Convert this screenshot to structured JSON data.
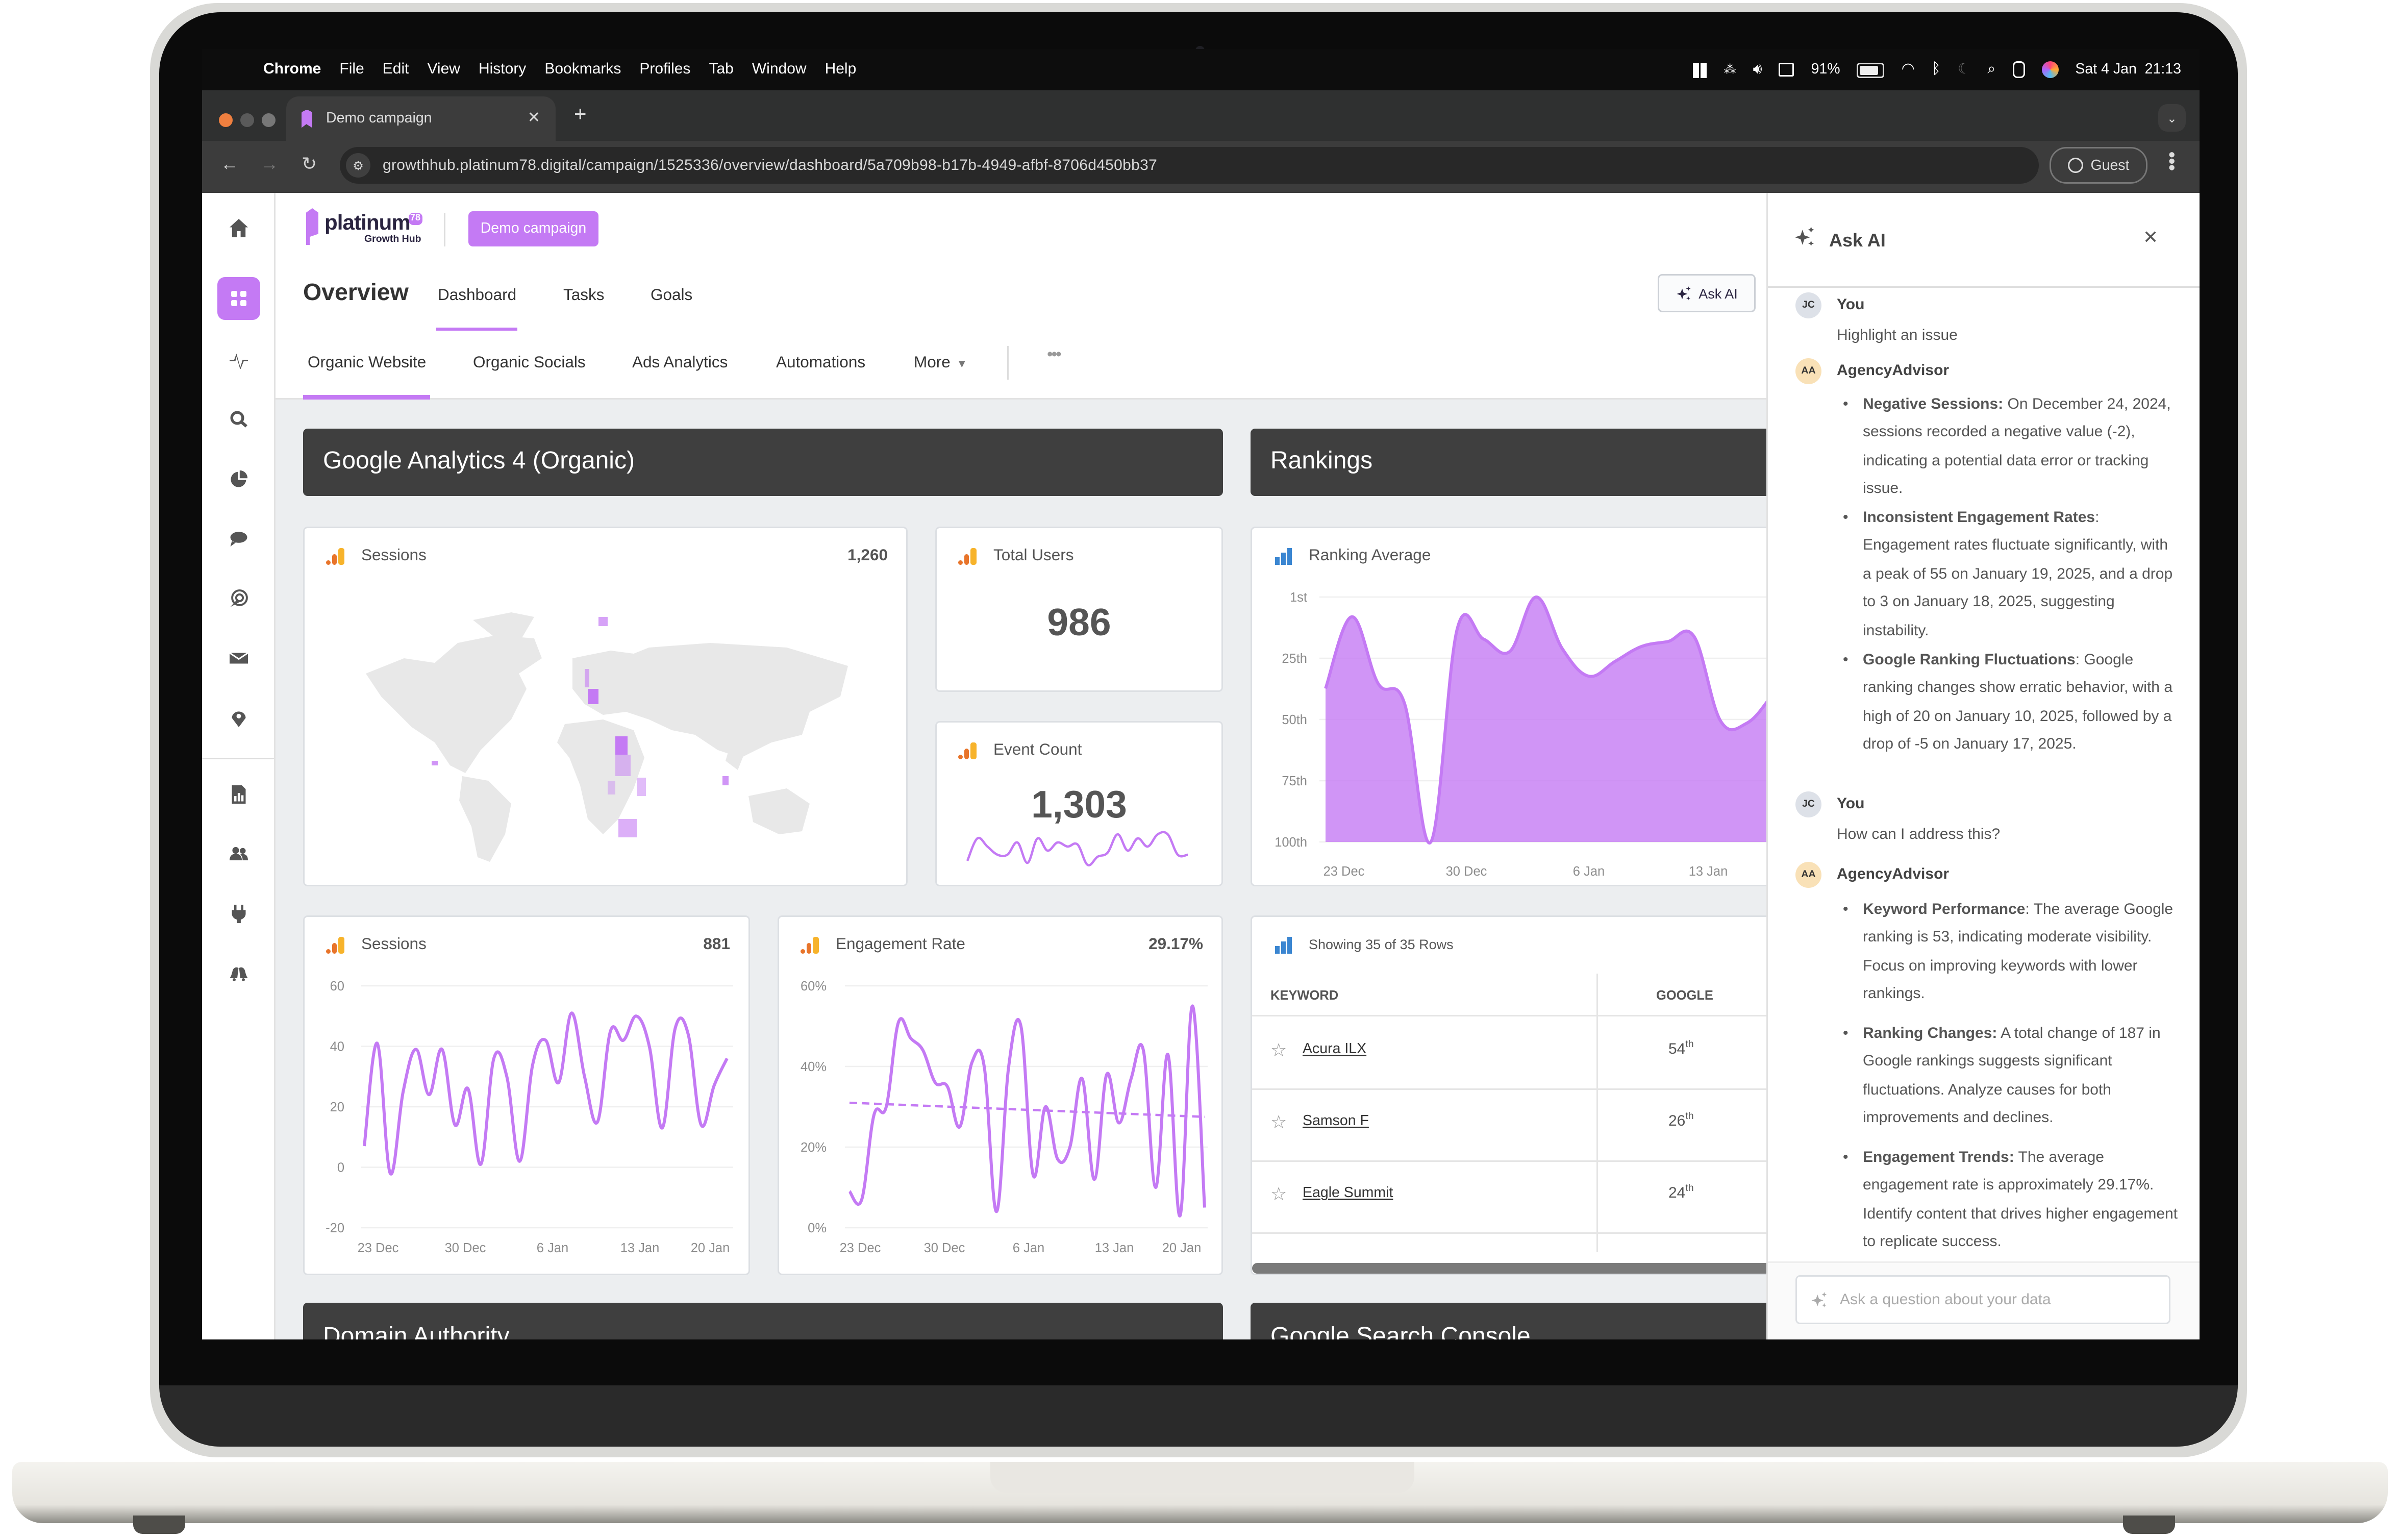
{
  "menubar": {
    "app_name": "Chrome",
    "items": [
      "File",
      "Edit",
      "View",
      "History",
      "Bookmarks",
      "Profiles",
      "Tab",
      "Window",
      "Help"
    ],
    "battery": "91%",
    "clock": "Sat 4 Jan  21:13"
  },
  "browser": {
    "tab_title": "Demo campaign",
    "url": "growthhub.platinum78.digital/campaign/1525336/overview/dashboard/5a709b98-b17b-4949-afbf-8706d450bb37",
    "profile_label": "Guest"
  },
  "app": {
    "logo": {
      "name": "platinum",
      "badge": "78",
      "subtitle": "Growth Hub"
    },
    "campaign_button": "Demo campaign",
    "page_title": "Overview",
    "primary_tabs": [
      {
        "label": "Dashboard",
        "active": true
      },
      {
        "label": "Tasks",
        "active": false
      },
      {
        "label": "Goals",
        "active": false
      }
    ],
    "ask_ai_button": "Ask AI",
    "secondary_tabs": [
      {
        "label": "Organic Website",
        "active": true
      },
      {
        "label": "Organic Socials",
        "active": false
      },
      {
        "label": "Ads Analytics",
        "active": false
      },
      {
        "label": "Automations",
        "active": false
      },
      {
        "label": "More",
        "active": false
      }
    ],
    "sidebar_icons": [
      "home-icon",
      "dashboard-grid-icon",
      "activity-pulse-icon",
      "search-icon",
      "pie-chart-icon",
      "chat-bubble-icon",
      "target-click-icon",
      "mail-icon",
      "location-pin-icon",
      "report-icon",
      "users-icon",
      "plug-icon",
      "bells-icon"
    ]
  },
  "sections": {
    "ga4": "Google Analytics 4 (Organic)",
    "rankings": "Rankings",
    "domain_authority": "Domain Authority",
    "search_console": "Google Search Console"
  },
  "cards": {
    "sessions_map": {
      "title": "Sessions",
      "value": "1,260"
    },
    "total_users": {
      "title": "Total Users",
      "value": "986"
    },
    "event_count": {
      "title": "Event Count",
      "value": "1,303"
    },
    "ranking_average": {
      "title": "Ranking Average"
    },
    "sessions_line": {
      "title": "Sessions",
      "value": "881"
    },
    "engagement_rate": {
      "title": "Engagement Rate",
      "value": "29.17%"
    },
    "keywords": {
      "caption": "Showing 35 of 35 Rows",
      "columns": [
        "KEYWORD",
        "GOOGLE"
      ],
      "rows": [
        {
          "keyword": "Acura ILX",
          "rank": "54",
          "suffix": "th"
        },
        {
          "keyword": "Samson F",
          "rank": "26",
          "suffix": "th"
        },
        {
          "keyword": "Eagle Summit",
          "rank": "24",
          "suffix": "th"
        }
      ]
    }
  },
  "chart_data": [
    {
      "id": "ranking_average",
      "type": "area",
      "title": "Ranking Average",
      "x_tick_labels": [
        "23 Dec",
        "30 Dec",
        "6 Jan",
        "13 Jan"
      ],
      "y_tick_labels": [
        "1st",
        "25th",
        "50th",
        "75th",
        "100th"
      ],
      "ylim": [
        1,
        100
      ],
      "y_inverted": true,
      "values": [
        38,
        9,
        36,
        44,
        100,
        14,
        18,
        23,
        1,
        22,
        33,
        27,
        21,
        19,
        17,
        51,
        52,
        40,
        24,
        29,
        6,
        22,
        8,
        30,
        34,
        28
      ],
      "color": "#c47af4",
      "grid": true
    },
    {
      "id": "sessions",
      "type": "line",
      "title": "Sessions",
      "x_tick_labels": [
        "23 Dec",
        "30 Dec",
        "6 Jan",
        "13 Jan",
        "20 Jan"
      ],
      "yticks": [
        60,
        40,
        20,
        0,
        -20
      ],
      "ylim": [
        -20,
        60
      ],
      "values": [
        7,
        41,
        -2,
        25,
        39,
        24,
        39,
        14,
        26,
        1,
        36,
        30,
        2,
        34,
        42,
        28,
        51,
        30,
        15,
        45,
        42,
        50,
        40,
        13,
        46,
        44,
        14,
        27,
        36
      ],
      "color": "#c47af4",
      "grid": true
    },
    {
      "id": "engagement_rate",
      "type": "line",
      "title": "Engagement Rate",
      "x_tick_labels": [
        "23 Dec",
        "30 Dec",
        "6 Jan",
        "13 Jan",
        "20 Jan"
      ],
      "yticks": [
        "60%",
        "40%",
        "20%",
        "0%"
      ],
      "ylim": [
        0,
        60
      ],
      "values": [
        9,
        7,
        28,
        30,
        51,
        47,
        44,
        36,
        35,
        25,
        41,
        40,
        4,
        40,
        50,
        13,
        30,
        17,
        20,
        37,
        12,
        38,
        26,
        37,
        44,
        10,
        43,
        3,
        55,
        5
      ],
      "trend_line": [
        31,
        27.5
      ],
      "color": "#c47af4",
      "grid": true
    },
    {
      "id": "event_count_sparkline",
      "type": "line",
      "title": "Event Count",
      "values": [
        3,
        14,
        10,
        6,
        6,
        12,
        2,
        14,
        8,
        12,
        10,
        11,
        1,
        5,
        7,
        16,
        8,
        14,
        10,
        16,
        16,
        6,
        6
      ],
      "color": "#c47af4"
    }
  ],
  "ai_panel": {
    "title": "Ask AI",
    "messages": [
      {
        "initials": "JC",
        "author": "You",
        "text": "Highlight an issue"
      },
      {
        "initials": "AA",
        "author": "AgencyAdvisor",
        "bullets": [
          {
            "bold": "Negative Sessions:",
            "text": " On December 24, 2024, sessions recorded a negative value (-2), indicating a potential data error or tracking issue."
          },
          {
            "bold": "Inconsistent Engagement Rates",
            "text": ": Engagement rates fluctuate significantly, with a peak of 55 on January 19, 2025, and a drop to 3 on January 18, 2025, suggesting instability."
          },
          {
            "bold": "Google Ranking Fluctuations",
            "text": ": Google ranking changes show erratic behavior, with a high of 20 on January 10, 2025, followed by a drop of -5 on January 17, 2025."
          }
        ]
      },
      {
        "initials": "JC",
        "author": "You",
        "text": "How can I address this?"
      },
      {
        "initials": "AA",
        "author": "AgencyAdvisor",
        "bullets": [
          {
            "bold": "Keyword Performance",
            "text": ": The average Google ranking is 53, indicating moderate visibility. Focus on improving keywords with lower rankings."
          },
          {
            "bold": "Ranking Changes:",
            "text": " A total change of 187 in Google rankings suggests significant fluctuations. Analyze causes for both improvements and declines."
          },
          {
            "bold": "Engagement Trends:",
            "text": " The average engagement rate is approximately 29.17%. Identify content that drives higher engagement to replicate success."
          }
        ]
      }
    ],
    "input_placeholder": "Ask a question about your data"
  },
  "colors": {
    "accent": "#c47af4",
    "section_bar": "#3f3f3f",
    "ga_orange": "#e8742a",
    "ga_yellow": "#f7b32b",
    "rank_blue": "#3b86d1"
  }
}
